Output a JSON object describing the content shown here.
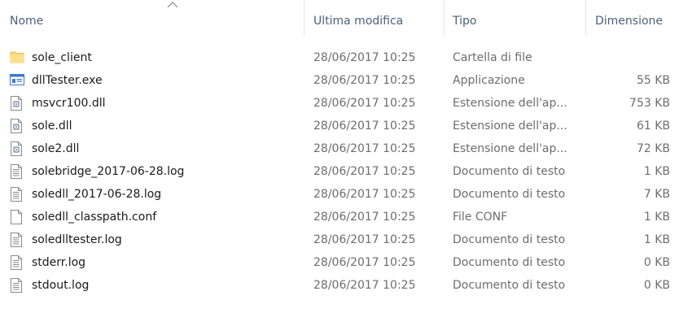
{
  "columns": {
    "name": "Nome",
    "modified": "Ultima modifica",
    "type": "Tipo",
    "size": "Dimensione"
  },
  "sort": {
    "column": "name",
    "icon": "sort-ascending-icon"
  },
  "files": [
    {
      "name": "sole_client",
      "modified": "28/06/2017 10:25",
      "type": "Cartella di file",
      "size": "",
      "icon": "folder-icon"
    },
    {
      "name": "dllTester.exe",
      "modified": "28/06/2017 10:25",
      "type": "Applicazione",
      "size": "55 KB",
      "icon": "application-icon"
    },
    {
      "name": "msvcr100.dll",
      "modified": "28/06/2017 10:25",
      "type": "Estensione dell'ap...",
      "size": "753 KB",
      "icon": "dll-icon"
    },
    {
      "name": "sole.dll",
      "modified": "28/06/2017 10:25",
      "type": "Estensione dell'ap...",
      "size": "61 KB",
      "icon": "dll-icon"
    },
    {
      "name": "sole2.dll",
      "modified": "28/06/2017 10:25",
      "type": "Estensione dell'ap...",
      "size": "72 KB",
      "icon": "dll-icon"
    },
    {
      "name": "solebridge_2017-06-28.log",
      "modified": "28/06/2017 10:25",
      "type": "Documento di testo",
      "size": "1 KB",
      "icon": "text-file-icon"
    },
    {
      "name": "soledll_2017-06-28.log",
      "modified": "28/06/2017 10:25",
      "type": "Documento di testo",
      "size": "7 KB",
      "icon": "text-file-icon"
    },
    {
      "name": "soledll_classpath.conf",
      "modified": "28/06/2017 10:25",
      "type": "File CONF",
      "size": "1 KB",
      "icon": "blank-file-icon"
    },
    {
      "name": "soledlltester.log",
      "modified": "28/06/2017 10:25",
      "type": "Documento di testo",
      "size": "1 KB",
      "icon": "text-file-icon"
    },
    {
      "name": "stderr.log",
      "modified": "28/06/2017 10:25",
      "type": "Documento di testo",
      "size": "0 KB",
      "icon": "text-file-icon"
    },
    {
      "name": "stdout.log",
      "modified": "28/06/2017 10:25",
      "type": "Documento di testo",
      "size": "0 KB",
      "icon": "text-file-icon"
    }
  ]
}
